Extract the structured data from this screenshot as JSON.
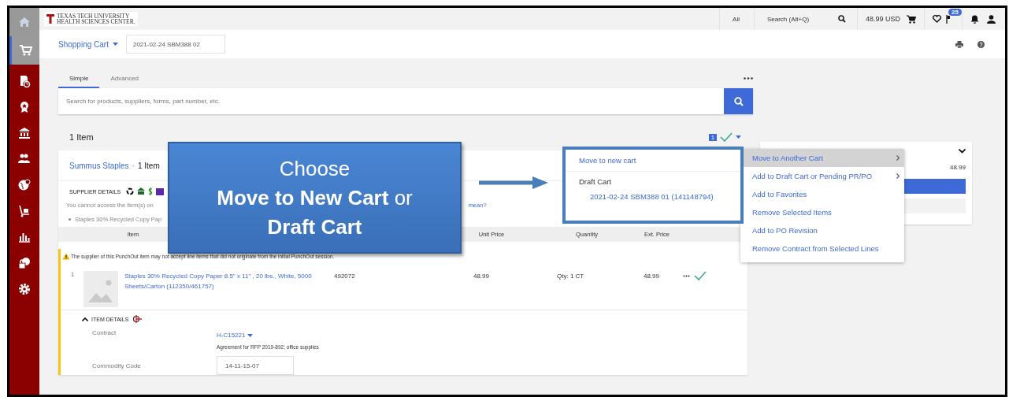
{
  "header": {
    "logo_lines": [
      "TEXAS TECH UNIVERSITY",
      "HEALTH SCIENCES CENTER."
    ],
    "scope": "All",
    "search_placeholder": "Search (Alt+Q)",
    "cart_total": "48.99 USD",
    "notification_count": "25"
  },
  "sidebar": {
    "items": [
      {
        "selected": false
      },
      {
        "selected": true
      },
      {
        "selected": false
      },
      {
        "selected": false
      },
      {
        "selected": false
      },
      {
        "selected": false
      },
      {
        "selected": false
      },
      {
        "selected": false
      },
      {
        "selected": false
      },
      {
        "selected": false
      },
      {
        "selected": false
      }
    ]
  },
  "page": {
    "title": "Shopping Cart",
    "cart_name": "2021-02-24 SBM388 02"
  },
  "search": {
    "tabs": [
      {
        "label": "Simple",
        "selected": true
      },
      {
        "label": "Advanced",
        "selected": false
      }
    ],
    "placeholder": "Search for products, suppliers, forms, part number, etc."
  },
  "cart": {
    "count_label": "1 Item",
    "selected_count": "1",
    "supplier": {
      "name": "Summus Staples",
      "separator": "·",
      "count": "1 Item",
      "details_label": "SUPPLIER DETAILS",
      "notice_start": "You cannot access the item(s) on",
      "notice_end": "mean?",
      "bullet": "Staples 30% Recycled Copy Pap"
    },
    "columns": [
      "Item",
      "Unit Price",
      "Quantity",
      "Ext. Price"
    ],
    "warning": "The supplier of this PunchOut item may not accept line items that did not originate from the initial PunchOut session.",
    "lines": [
      {
        "number": "1",
        "description": "Staples 30% Recycled Copy Paper 8.5\" x 11\" , 20 lbs., White, 5000 Sheets/Carton (112350/461757)",
        "part": "492072",
        "unit_price": "48.99",
        "quantity": "Qty: 1 CT",
        "ext_price": "48.99",
        "checked": true
      }
    ],
    "details": {
      "label": "ITEM DETAILS",
      "expanded": true,
      "contract_label": "Contract",
      "contract": "H-C15221",
      "contract_note": "Agreement for RFP 2019-892; office supplies",
      "commodity_label": "Commodity Code",
      "commodity": "14-11-15-07"
    }
  },
  "summary": {
    "total": "48.99"
  },
  "menu": [
    {
      "label": "Move to Another Cart",
      "selected": true,
      "submenu": true
    },
    {
      "label": "Add to Draft Cart or Pending PR/PO",
      "selected": false,
      "submenu": true
    },
    {
      "label": "Add to Favorites",
      "selected": false,
      "submenu": false
    },
    {
      "label": "Remove Selected Items",
      "selected": false,
      "submenu": false
    },
    {
      "label": "Add to PO Revision",
      "selected": false,
      "submenu": false
    },
    {
      "label": "Remove Contract from Selected Lines",
      "selected": false,
      "submenu": false
    }
  ],
  "submenu": {
    "new_cart": "Move to new cart",
    "heading": "Draft Cart",
    "carts": [
      "2021-02-24 SBM388 01 (141148794)"
    ]
  },
  "callout": {
    "lines": [
      "Choose",
      "**Move to New Cart** or",
      "**Draft Cart**"
    ]
  }
}
